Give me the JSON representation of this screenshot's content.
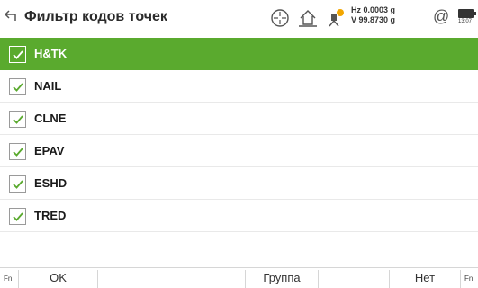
{
  "titlebar": {
    "title": "Фильтр кодов точек",
    "hz": "Hz 0.0003 g",
    "v": "V  99.8730 g",
    "at_symbol": "@",
    "time": "13:07"
  },
  "codes": [
    {
      "label": "H&TK",
      "checked": true,
      "selected": true
    },
    {
      "label": "NAIL",
      "checked": true,
      "selected": false
    },
    {
      "label": "CLNE",
      "checked": true,
      "selected": false
    },
    {
      "label": "EPAV",
      "checked": true,
      "selected": false
    },
    {
      "label": "ESHD",
      "checked": true,
      "selected": false
    },
    {
      "label": "TRED",
      "checked": true,
      "selected": false
    }
  ],
  "softkeys": {
    "fn_left": "Fn",
    "ok": "OK",
    "group": "Группа",
    "none": "Нет",
    "fn_right": "Fn"
  },
  "colors": {
    "selected_row": "#5aaa2e",
    "check_green": "#5aaa2e",
    "warning_dot": "#f2a600"
  }
}
